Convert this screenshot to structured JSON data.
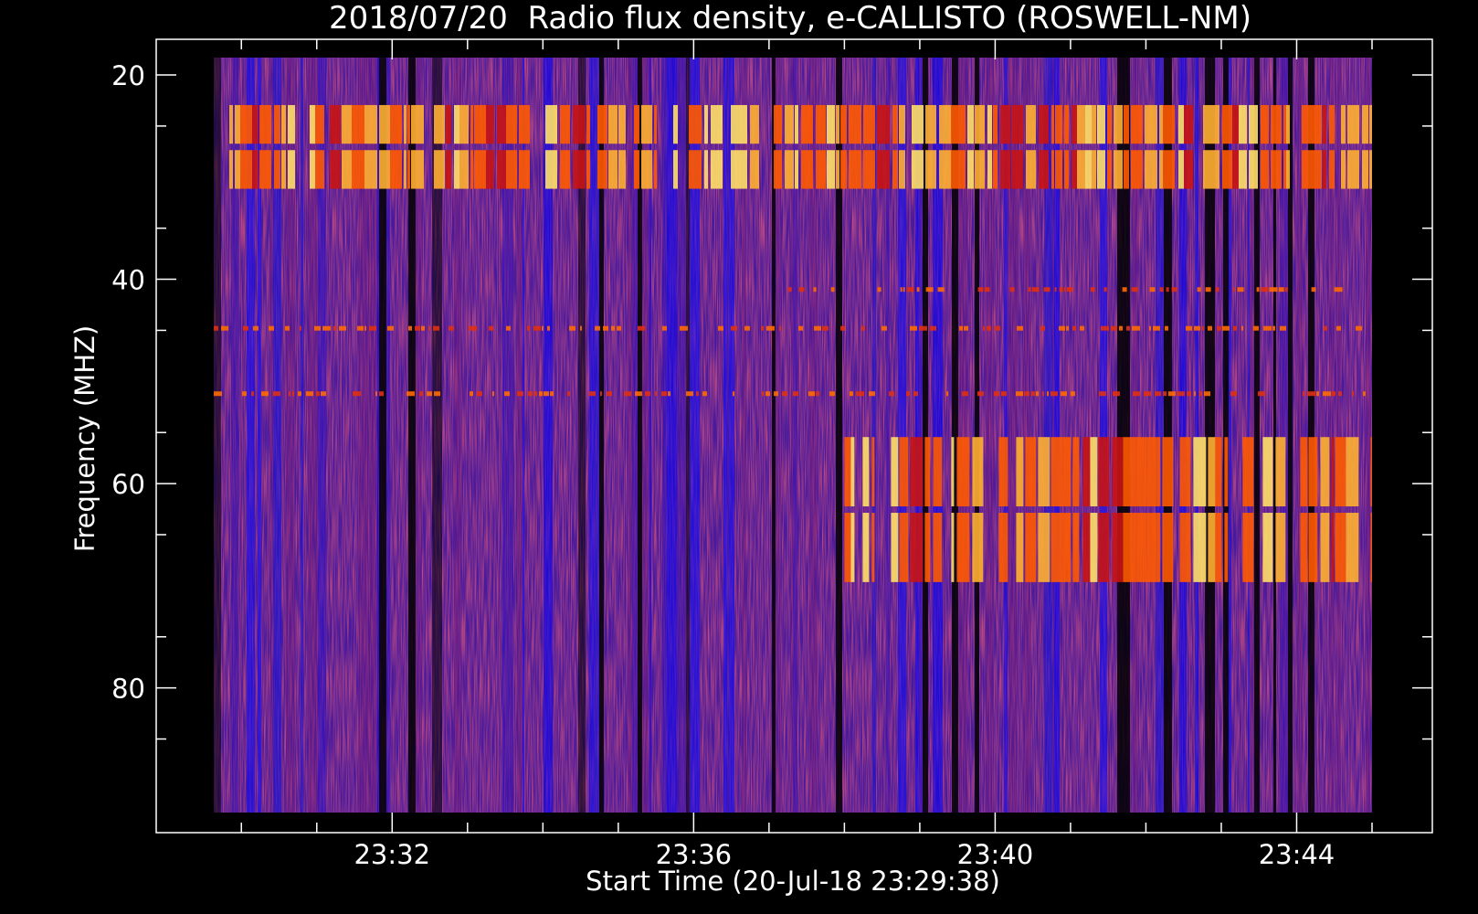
{
  "chart_data": {
    "type": "heatmap",
    "title": "2018/07/20  Radio flux density, e-CALLISTO (ROSWELL-NM)",
    "xlabel": "Start Time (20-Jul-18 23:29:38)",
    "ylabel": "Frequency (MHZ)",
    "x_ticks": [
      "23:32",
      "23:36",
      "23:40",
      "23:44"
    ],
    "y_ticks": [
      "20",
      "40",
      "60",
      "80"
    ],
    "xlim": [
      "23:29:38",
      "23:45:00"
    ],
    "ylim": [
      92.2,
      18.3
    ],
    "y_inverted": true,
    "grid": false,
    "colormap": [
      "#000000",
      "#0000ff",
      "#5a1aa8",
      "#8a1a6a",
      "#c81414",
      "#ff6a00",
      "#ffe066"
    ],
    "colors": {
      "background": "#000000",
      "axes": "#ffffff",
      "low_intensity": "#0000ff",
      "high_intensity": "#ffd700"
    },
    "features": [
      {
        "label": "strong interference bands",
        "freq_range_mhz": [
          22.5,
          31.5
        ],
        "time": "23:29:38-23:45:00"
      },
      {
        "label": "narrowband line",
        "freq_mhz": 41.0,
        "time": "23:37:10-23:44:30"
      },
      {
        "label": "narrowband line",
        "freq_mhz": 44.8,
        "time": "23:29:38-23:45:00"
      },
      {
        "label": "narrowband line",
        "freq_mhz": 51.2,
        "time": "23:29:38-23:45:00"
      },
      {
        "label": "elevated emission",
        "freq_range_mhz": [
          55.0,
          70.0
        ],
        "time": "23:38:00-23:45:00"
      }
    ]
  }
}
